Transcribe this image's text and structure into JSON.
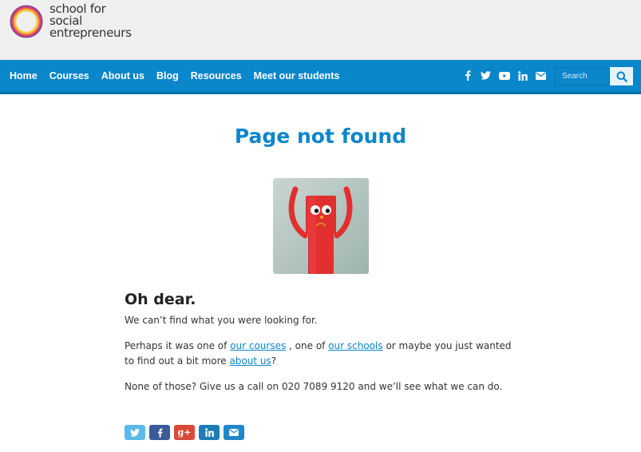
{
  "brand": {
    "logo_lines": [
      "school for",
      "social",
      "entrepreneurs"
    ]
  },
  "nav": {
    "items": [
      "Home",
      "Courses",
      "About us",
      "Blog",
      "Resources",
      "Meet our students"
    ]
  },
  "social_icons": [
    "facebook-icon",
    "twitter-icon",
    "youtube-icon",
    "linkedin-icon",
    "email-icon"
  ],
  "search": {
    "placeholder": "Search"
  },
  "main": {
    "title": "Page not found",
    "heading": "Oh dear.",
    "line1": "We can’t find what you were looking for.",
    "p2_prefix": "Perhaps it was one of ",
    "link_courses": "our courses",
    "p2_mid1": " , one of ",
    "link_schools": "our schools",
    "p2_mid2": "  or maybe you just wanted to find out a bit more ",
    "link_about": "about us",
    "p2_suffix": "?",
    "line3": "None of those? Give us a call on 020 7089 9120 and we’ll see what we can do."
  },
  "share": {
    "buttons": [
      {
        "icon": "twitter-icon",
        "color": "#5cb8e8"
      },
      {
        "icon": "facebook-icon",
        "color": "#3a5a98"
      },
      {
        "icon": "google-plus-icon",
        "color": "#d94a38",
        "glyph": "g+"
      },
      {
        "icon": "linkedin-icon",
        "color": "#1d7bb5"
      },
      {
        "icon": "email-icon",
        "color": "#1f87c8"
      }
    ]
  },
  "colors": {
    "brand_blue": "#0a86cb",
    "header_bg": "#efefef"
  }
}
